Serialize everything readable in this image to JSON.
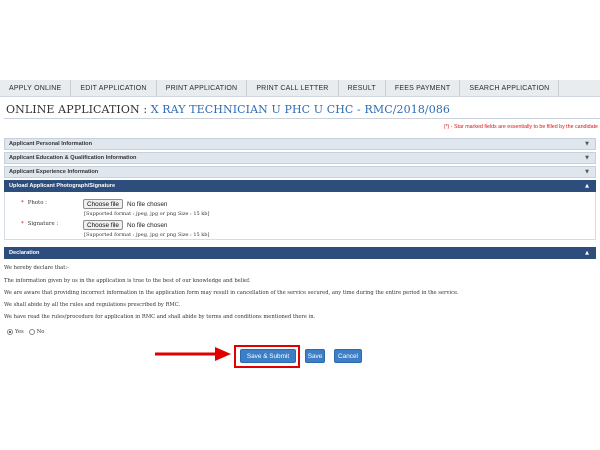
{
  "nav": {
    "items": [
      {
        "label": "APPLY ONLINE"
      },
      {
        "label": "EDIT APPLICATION"
      },
      {
        "label": "PRINT APPLICATION"
      },
      {
        "label": "PRINT CALL LETTER"
      },
      {
        "label": "RESULT"
      },
      {
        "label": "FEES PAYMENT"
      },
      {
        "label": "SEARCH APPLICATION"
      }
    ]
  },
  "header": {
    "title_prefix": "ONLINE APPLICATION : ",
    "post_name": "X RAY TECHNICIAN U PHC U CHC - RMC/2018/086"
  },
  "star_note": "(*) - Star marked fields are essentially to be filled by the candidate",
  "sections": {
    "personal": "Applicant Personal Information",
    "education": "Applicant Education & Qualification Information",
    "experience": "Applicant Experience Information",
    "upload": "Applicant Photograph/Signature",
    "declaration": "Declaration"
  },
  "upload": {
    "photo_label": "Photo :",
    "signature_label": "Signature :",
    "required_mark": "*",
    "choose_file_label": "Choose file",
    "no_file_text": "No file chosen",
    "format_note": "[Supported format : jpeg, jpg or png Size : 15 kb]",
    "upload_prefix": "Upload"
  },
  "declaration": {
    "lines": [
      "We hereby declare that:-",
      "The information given by us in the application is true to the best of our knowledge and belief.",
      "We are aware that providing incorrect information in the application form may result in cancellation of the service secured, any time during the entire period in the service.",
      "We shall abide by all the rules and regulations prescribed by RMC.",
      "We have read the rules/procedure for application in RMC and shall abide by terms and conditions mentioned there in."
    ],
    "yes_label": "Yes",
    "no_label": "No",
    "selected": "Yes"
  },
  "actions": {
    "save_submit_label": "Save & Submit",
    "save_label": "Save",
    "cancel_label": "Cancel"
  },
  "colors": {
    "highlight": "#e00000",
    "button": "#3d7fc6",
    "section_active": "#2d4e7d",
    "post_name": "#2f6db3"
  },
  "icons": {
    "collapsed": "chevron-down-icon",
    "expanded": "chevron-up-icon"
  }
}
